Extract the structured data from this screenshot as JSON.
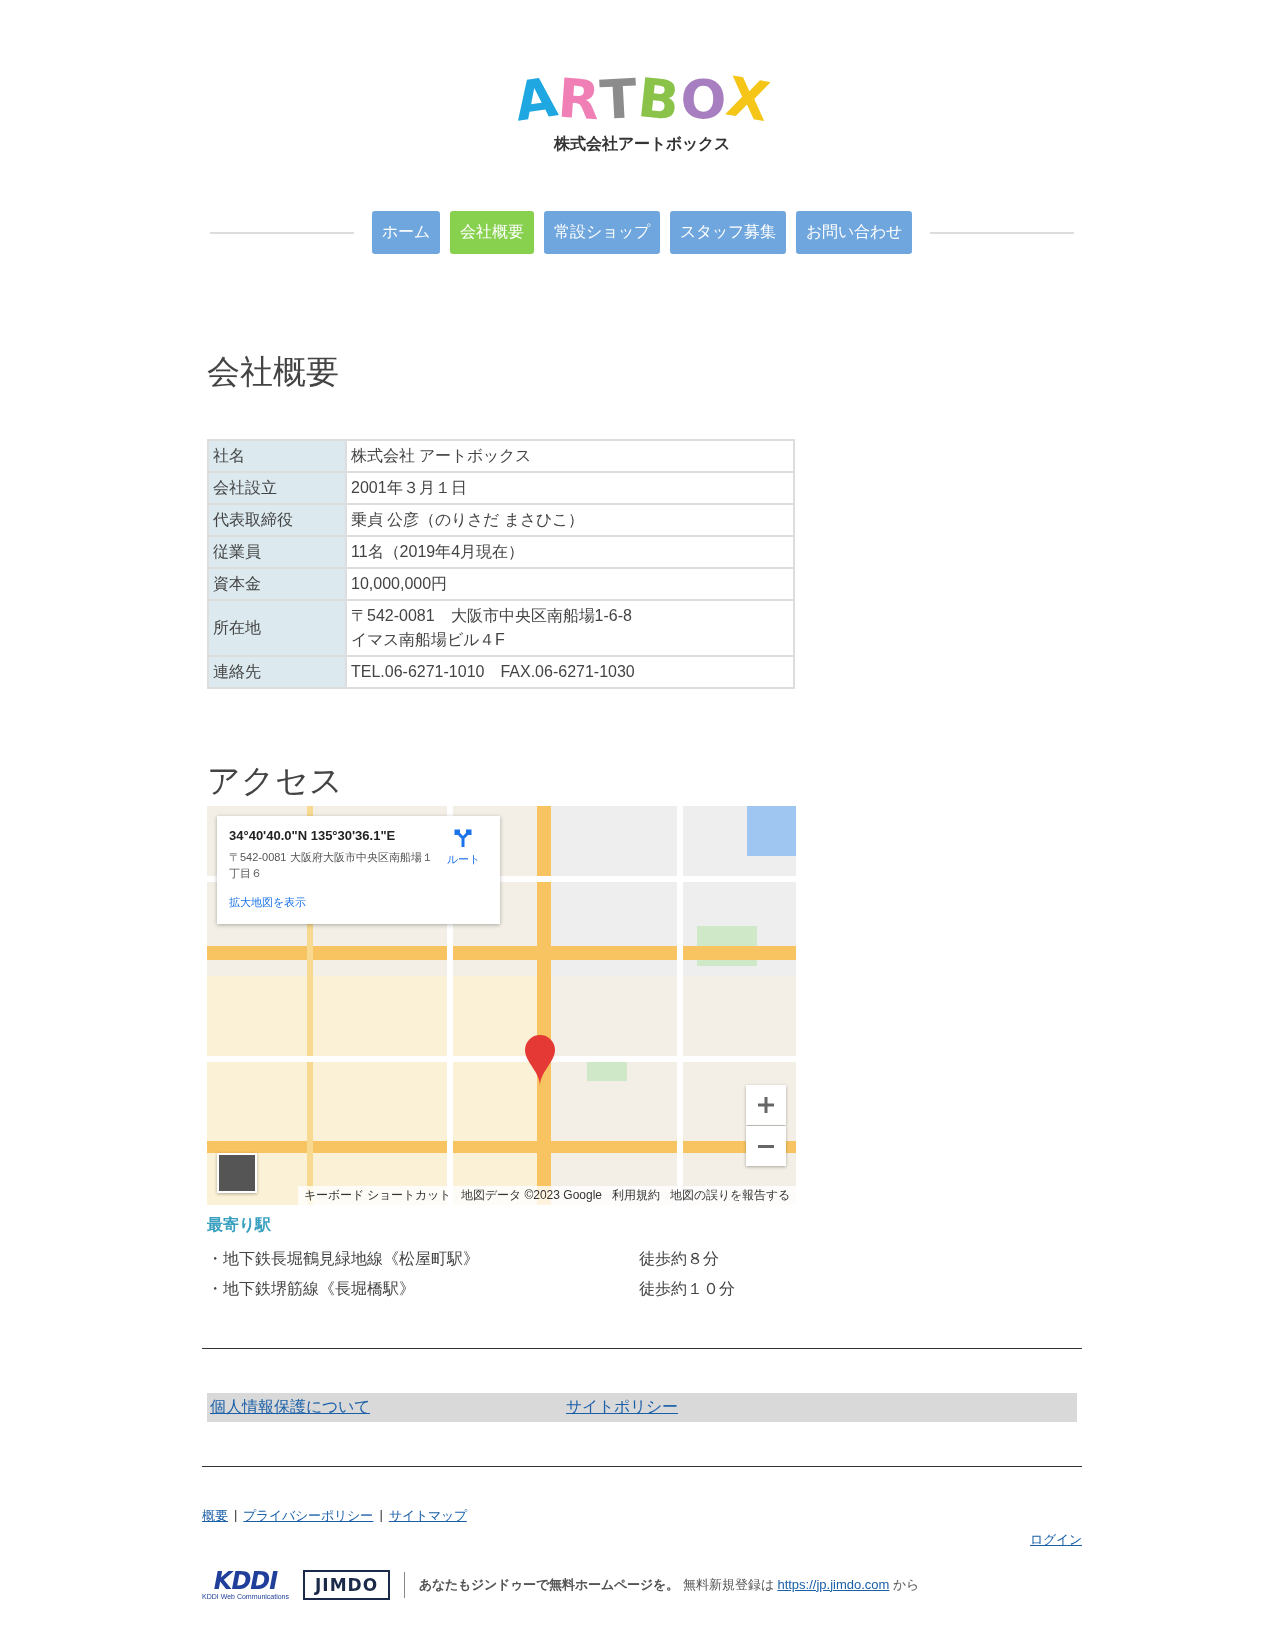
{
  "logo": {
    "letters": [
      {
        "char": "A",
        "color": "#1ea7e0"
      },
      {
        "char": "R",
        "color": "#f07fb5"
      },
      {
        "char": "T",
        "color": "#8c8c8c"
      },
      {
        "char": "B",
        "color": "#8bc34a"
      },
      {
        "char": "O",
        "color": "#a77fc0"
      },
      {
        "char": "X",
        "color": "#f5c518"
      }
    ],
    "subtitle": "株式会社アートボックス"
  },
  "nav": [
    {
      "label": "ホーム",
      "selected": false
    },
    {
      "label": "会社概要",
      "selected": true
    },
    {
      "label": "常設ショップ",
      "selected": false
    },
    {
      "label": "スタッフ募集",
      "selected": false
    },
    {
      "label": "お問い合わせ",
      "selected": false
    }
  ],
  "company": {
    "heading": "会社概要",
    "rows": [
      {
        "label": "社名",
        "value_lines": [
          "株式会社 アートボックス"
        ]
      },
      {
        "label": "会社設立",
        "value_lines": [
          "2001年３月１日"
        ]
      },
      {
        "label": "代表取締役",
        "value_lines": [
          "乗貞 公彦（のりさだ まさひこ）"
        ]
      },
      {
        "label": "従業員",
        "value_lines": [
          "11名（2019年4月現在）"
        ]
      },
      {
        "label": "資本金",
        "value_lines": [
          "10,000,000円"
        ]
      },
      {
        "label": "所在地",
        "value_lines": [
          "〒542-0081　大阪市中央区南船場1-6-8",
          "イマス南船場ビル４F"
        ]
      },
      {
        "label": "連絡先",
        "value_lines": [
          "TEL.06-6271-1010　FAX.06-6271-1030"
        ]
      }
    ]
  },
  "access": {
    "heading": "アクセス",
    "map": {
      "kind": "picture",
      "coords": "34°40'40.0\"N 135°30'36.1\"E",
      "address": "〒542-0081 大阪府大阪市中央区南船場１丁目６",
      "larger_map_link": "拡大地図を表示",
      "route_label": "ルート",
      "attribution": [
        "キーボード ショートカット",
        "地図データ ©2023 Google",
        "利用規約",
        "地図の誤りを報告する"
      ]
    }
  },
  "nearest": {
    "heading": "最寄り駅",
    "stations": [
      {
        "line": "・地下鉄長堀鶴見緑地線《松屋町駅》",
        "walk": "徒歩約８分"
      },
      {
        "line": "・地下鉄堺筋線《長堀橋駅》",
        "walk": "徒歩約１０分"
      }
    ]
  },
  "links_bar": [
    "個人情報保護について",
    "サイトポリシー"
  ],
  "footer": {
    "links": [
      {
        "label": "概要",
        "separator": "|"
      },
      {
        "label": "プライバシーポリシー",
        "separator": "|"
      },
      {
        "label": "サイトマップ"
      }
    ],
    "login": "ログイン",
    "kddi": {
      "mark": "KDDI",
      "sub": "KDDI Web Communications"
    },
    "jimdo": "JIMDO",
    "promo_bold": "あなたもジンドゥーで無料ホームページを。",
    "promo": "無料新規登録は",
    "url": "https://jp.jimdo.com",
    "suffix": "から"
  }
}
